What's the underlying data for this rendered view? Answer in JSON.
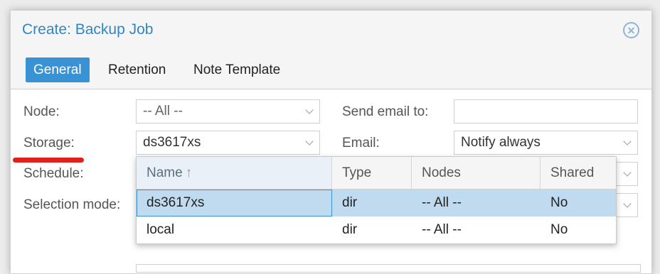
{
  "dialog": {
    "title": "Create: Backup Job",
    "close_icon": "close-circle-icon"
  },
  "tabs": [
    {
      "label": "General",
      "active": true
    },
    {
      "label": "Retention",
      "active": false
    },
    {
      "label": "Note Template",
      "active": false
    }
  ],
  "form": {
    "node": {
      "label": "Node:",
      "value": "-- All --"
    },
    "storage": {
      "label": "Storage:",
      "value": "ds3617xs"
    },
    "schedule": {
      "label": "Schedule:"
    },
    "selection_mode": {
      "label": "Selection mode:"
    },
    "send_email": {
      "label": "Send email to:",
      "value": ""
    },
    "email": {
      "label": "Email:",
      "value": "Notify always"
    }
  },
  "storage_dropdown": {
    "columns": [
      "Name",
      "Type",
      "Nodes",
      "Shared"
    ],
    "sort_icon": "arrow-up-icon",
    "rows": [
      {
        "name": "ds3617xs",
        "type": "dir",
        "nodes": "-- All --",
        "shared": "No",
        "selected": true
      },
      {
        "name": "local",
        "type": "dir",
        "nodes": "-- All --",
        "shared": "No",
        "selected": false
      }
    ]
  },
  "colors": {
    "accent": "#3892d3",
    "title": "#3186c4",
    "selected_row": "#c0dbf0",
    "annotation": "#e0201c"
  }
}
